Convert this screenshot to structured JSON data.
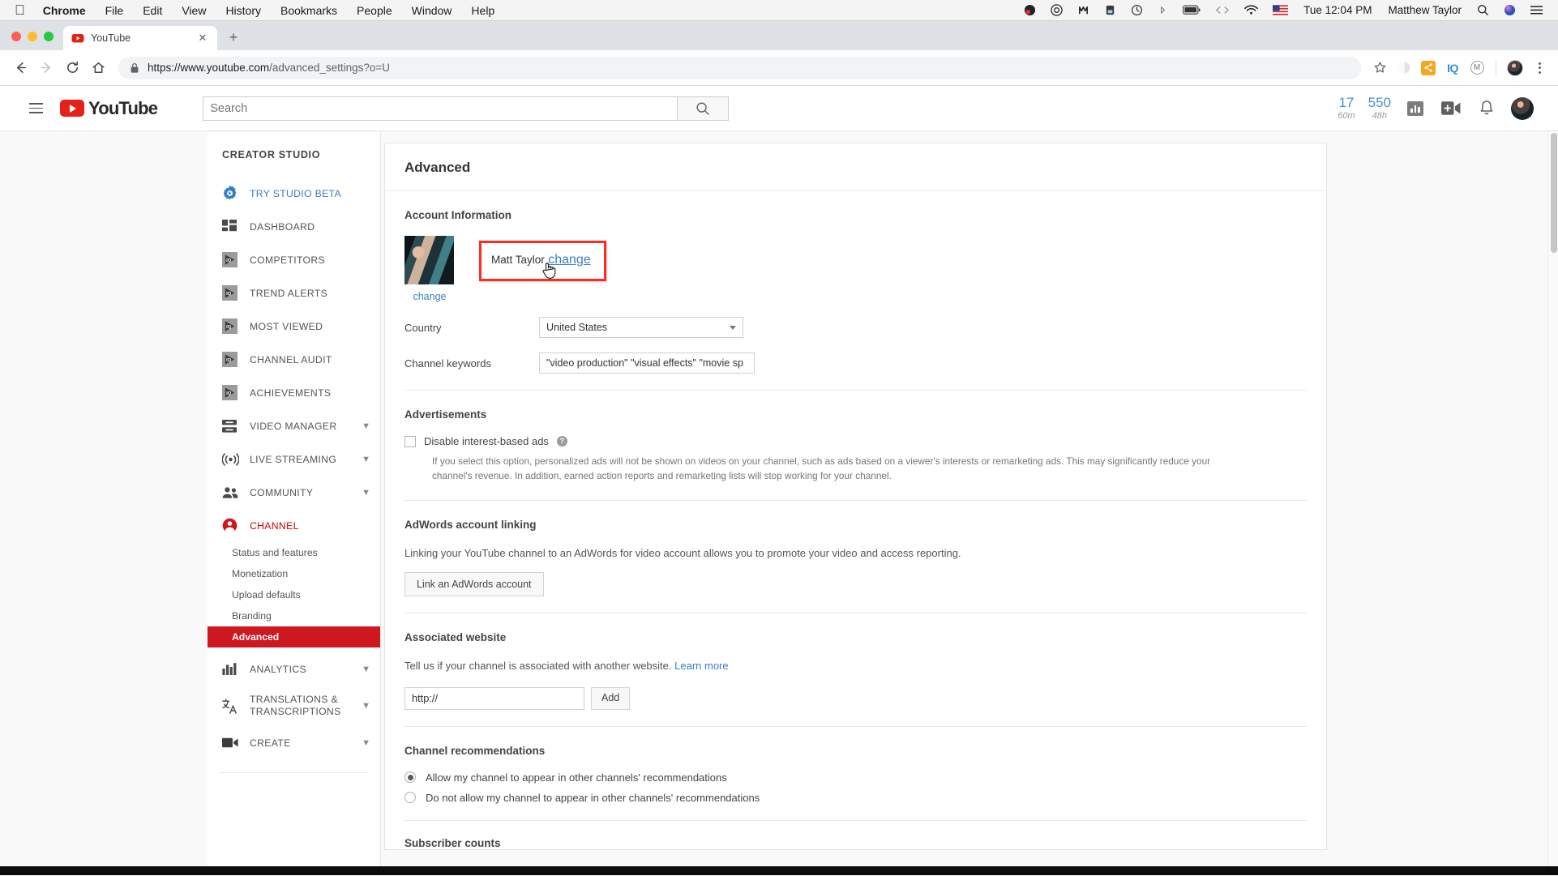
{
  "macbar": {
    "apple_icon": "apple-icon",
    "items": [
      "Chrome",
      "File",
      "Edit",
      "View",
      "History",
      "Bookmarks",
      "People",
      "Window",
      "Help"
    ],
    "status_icons": [
      "obs-icon",
      "creative-cloud-icon",
      "bartender-icon",
      "backup-icon",
      "time-machine-icon",
      "bluetooth-icon",
      "battery-icon",
      "code-icon",
      "wifi-icon",
      "flag-us-icon"
    ],
    "time": "Tue 12:04 PM",
    "user": "Matthew Taylor",
    "search_icon": "spotlight-search-icon",
    "siri_icon": "siri-icon",
    "control_center_icon": "notification-center-icon"
  },
  "browser": {
    "tab": {
      "title": "YouTube",
      "favicon": "youtube-favicon",
      "close_icon": "close-icon"
    },
    "new_tab_label": "+",
    "nav": {
      "back_icon": "back-arrow-icon",
      "forward_icon": "forward-arrow-icon",
      "reload_icon": "reload-icon",
      "home_icon": "home-icon"
    },
    "omnibox": {
      "lock_icon": "lock-icon",
      "url_strong": "https://www.youtube.com",
      "url_dim": "/advanced_settings?o=U",
      "full_url": "https://www.youtube.com/advanced_settings?o=U"
    },
    "toolbar_icons": [
      "bookmark-star-icon",
      "extension-circle-icon",
      "extension-share-icon",
      "vidiq-extension-icon",
      "grammarly-extension-icon",
      "profile-avatar-icon",
      "chrome-menu-icon"
    ],
    "vidiq_label": "IQ",
    "grammarly_label": "M"
  },
  "youtube": {
    "hamburger_icon": "hamburger-menu-icon",
    "logo": {
      "icon": "youtube-play-icon",
      "word": "YouTube"
    },
    "search": {
      "placeholder": "Search",
      "value": "",
      "button_icon": "search-icon"
    },
    "stats": [
      {
        "num": "17",
        "sub": "60m"
      },
      {
        "num": "550",
        "sub": "48h"
      }
    ],
    "header_icons": [
      "analytics-bars-icon",
      "upload-video-icon",
      "notifications-bell-icon",
      "account-avatar-icon"
    ]
  },
  "sidebar": {
    "title": "CREATOR STUDIO",
    "items": [
      {
        "label": "TRY STUDIO BETA",
        "icon": "gear-blue-icon",
        "style": "blue",
        "chevron": false
      },
      {
        "label": "DASHBOARD",
        "icon": "dashboard-grid-icon",
        "style": "",
        "chevron": false
      },
      {
        "label": "COMPETITORS",
        "icon": "vidiq-play-icon",
        "style": "",
        "chevron": false
      },
      {
        "label": "TREND ALERTS",
        "icon": "vidiq-play-icon",
        "style": "",
        "chevron": false
      },
      {
        "label": "MOST VIEWED",
        "icon": "vidiq-play-icon",
        "style": "",
        "chevron": false
      },
      {
        "label": "CHANNEL AUDIT",
        "icon": "vidiq-play-icon",
        "style": "",
        "chevron": false
      },
      {
        "label": "ACHIEVEMENTS",
        "icon": "vidiq-play-icon",
        "style": "",
        "chevron": false
      },
      {
        "label": "VIDEO MANAGER",
        "icon": "video-manager-icon",
        "style": "",
        "chevron": true
      },
      {
        "label": "LIVE STREAMING",
        "icon": "live-streaming-icon",
        "style": "",
        "chevron": true
      },
      {
        "label": "COMMUNITY",
        "icon": "community-people-icon",
        "style": "",
        "chevron": true
      },
      {
        "label": "CHANNEL",
        "icon": "channel-person-icon",
        "style": "red",
        "chevron": false
      }
    ],
    "sub_items": [
      {
        "label": "Status and features",
        "active": false
      },
      {
        "label": "Monetization",
        "active": false
      },
      {
        "label": "Upload defaults",
        "active": false
      },
      {
        "label": "Branding",
        "active": false
      },
      {
        "label": "Advanced",
        "active": true
      }
    ],
    "items_after": [
      {
        "label": "ANALYTICS",
        "icon": "analytics-bars-icon",
        "style": "",
        "chevron": true
      },
      {
        "label": "TRANSLATIONS & TRANSCRIPTIONS",
        "icon": "translate-icon",
        "style": "",
        "chevron": true
      },
      {
        "label": "CREATE",
        "icon": "create-camera-icon",
        "style": "",
        "chevron": true
      }
    ]
  },
  "main": {
    "page_title": "Advanced",
    "account": {
      "heading": "Account Information",
      "avatar_icon": "channel-thumbnail",
      "avatar_change_link": "change",
      "display_name": "Matt Taylor",
      "name_change_link": "change",
      "highlight_color": "#fe2b1e",
      "cursor_icon": "pointing-hand-cursor",
      "country_label": "Country",
      "country_value": "United States",
      "country_options": [
        "United States"
      ],
      "keywords_label": "Channel keywords",
      "keywords_value": "\"video production\" \"visual effects\" \"movie sp"
    },
    "advertisements": {
      "heading": "Advertisements",
      "checkbox_label": "Disable interest-based ads",
      "checkbox_checked": false,
      "help_icon": "help-question-icon",
      "description": "If you select this option, personalized ads will not be shown on videos on your channel, such as ads based on a viewer's interests or remarketing ads. This may significantly reduce your channel's revenue. In addition, earned action reports and remarketing lists will stop working for your channel."
    },
    "adwords": {
      "heading": "AdWords account linking",
      "description": "Linking your YouTube channel to an AdWords for video account allows you to promote your video and access reporting.",
      "button_label": "Link an AdWords account"
    },
    "associated_website": {
      "heading": "Associated website",
      "description": "Tell us if your channel is associated with another website.",
      "learn_more": "Learn more",
      "input_value": "http://",
      "add_button": "Add"
    },
    "recommendations": {
      "heading": "Channel recommendations",
      "options": [
        {
          "label": "Allow my channel to appear in other channels' recommendations",
          "selected": true
        },
        {
          "label": "Do not allow my channel to appear in other channels' recommendations",
          "selected": false
        }
      ]
    },
    "next_section_heading": "Subscriber counts"
  }
}
